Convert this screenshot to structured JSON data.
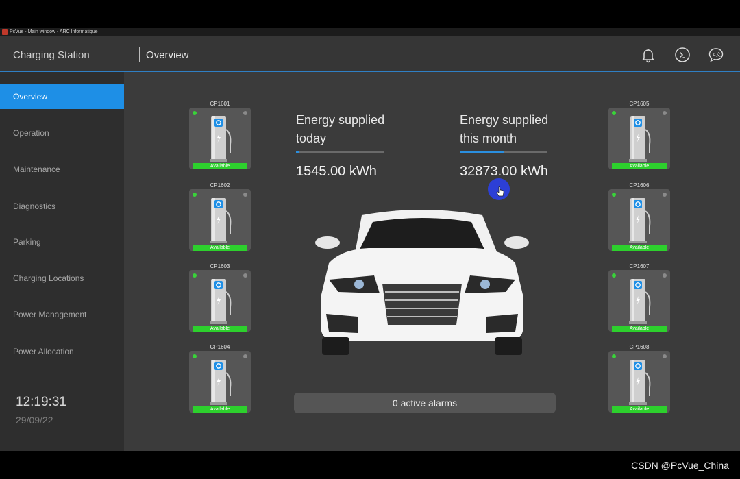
{
  "window": {
    "title": "PcVue - Main window - ARC Informatique"
  },
  "header": {
    "app_title": "Charging Station",
    "page_title": "Overview"
  },
  "header_icons": [
    "bell-icon",
    "terminal-icon",
    "translate-chat-icon"
  ],
  "sidebar": {
    "items": [
      {
        "label": "Overview",
        "active": true
      },
      {
        "label": "Operation"
      },
      {
        "label": "Maintenance"
      },
      {
        "label": "Diagnostics"
      },
      {
        "label": "Parking"
      },
      {
        "label": "Charging Locations"
      },
      {
        "label": "Power Management"
      },
      {
        "label": "Power Allocation"
      }
    ],
    "time": "12:19:31",
    "date": "29/09/22"
  },
  "chargers_left": [
    {
      "id": "CP1601",
      "status": "Available"
    },
    {
      "id": "CP1602",
      "status": "Available"
    },
    {
      "id": "CP1603",
      "status": "Available"
    },
    {
      "id": "CP1604",
      "status": "Available"
    }
  ],
  "chargers_right": [
    {
      "id": "CP1605",
      "status": "Available"
    },
    {
      "id": "CP1606",
      "status": "Available"
    },
    {
      "id": "CP1607",
      "status": "Available"
    },
    {
      "id": "CP1608",
      "status": "Available"
    }
  ],
  "energy": {
    "today": {
      "label_line1": "Energy supplied",
      "label_line2": "today",
      "value": "1545.00 kWh",
      "progress": 0.03
    },
    "month": {
      "label_line1": "Energy supplied",
      "label_line2": "this month",
      "value": "32873.00 kWh",
      "progress": 0.5
    }
  },
  "alarms": {
    "text": "0 active alarms"
  },
  "watermark": "CSDN @PcVue_China",
  "colors": {
    "accent": "#1e8fe6",
    "available": "#2dd02d",
    "led_on": "#39d339"
  }
}
